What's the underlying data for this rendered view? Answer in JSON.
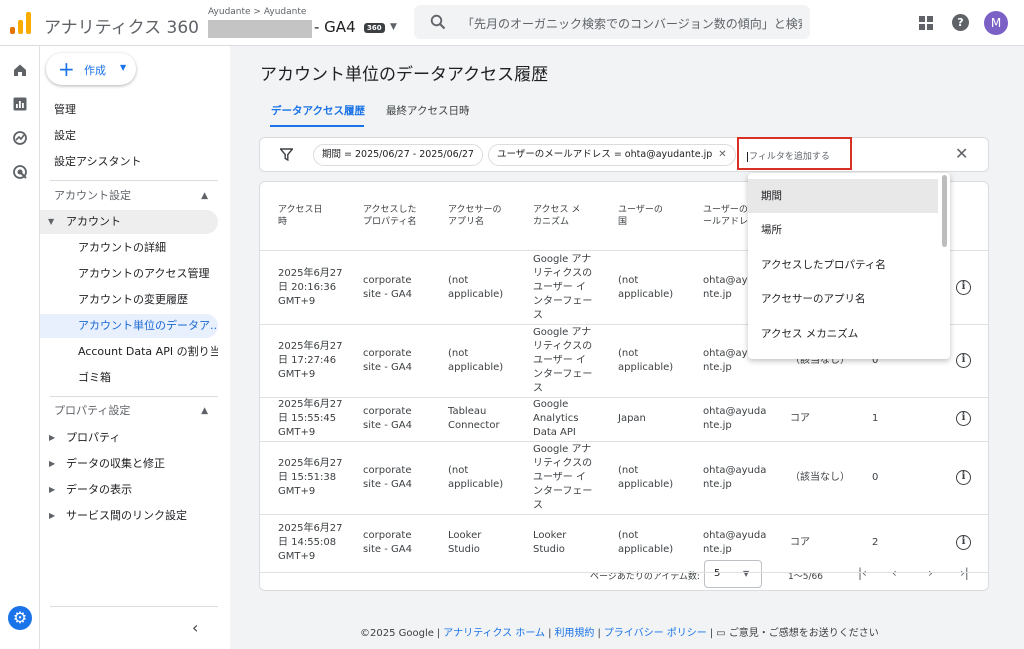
{
  "app": {
    "title": "アナリティクス 360",
    "account_crumb": "Ayudante > Ayudante",
    "property_name": "- GA4",
    "property_badge": "360"
  },
  "search": {
    "placeholder": "「先月のオーガニック検索でのコンバージョン数の傾向」と検索..."
  },
  "user": {
    "avatar_letter": "M"
  },
  "create_button": {
    "label": "作成"
  },
  "nav": {
    "top_items": [
      "管理",
      "設定",
      "設定アシスタント"
    ],
    "account_section": "アカウント設定",
    "account_group": "アカウント",
    "account_items": [
      "アカウントの詳細",
      "アカウントのアクセス管理",
      "アカウントの変更履歴",
      "アカウント単位のデータア...",
      "Account Data API の割り当...",
      "ゴミ箱"
    ],
    "property_section": "プロパティ設定",
    "property_groups": [
      "プロパティ",
      "データの収集と修正",
      "データの表示",
      "サービス間のリンク設定"
    ]
  },
  "page": {
    "title": "アカウント単位のデータアクセス履歴"
  },
  "tabs": [
    "データアクセス履歴",
    "最終アクセス日時"
  ],
  "filters": {
    "chips": [
      "期間 = 2025/06/27 - 2025/06/27",
      "ユーザーのメールアドレス = ohta@ayudante.jp"
    ],
    "input_placeholder": "フィルタを追加する"
  },
  "table": {
    "headers": [
      [
        "アクセス日",
        "時"
      ],
      [
        "アクセスした",
        "プロパティ名"
      ],
      [
        "アクセサーの",
        "アプリ名"
      ],
      [
        "アクセス メ",
        "カニズム"
      ],
      [
        "ユーザーの",
        "国"
      ],
      [
        "ユーザーのメ",
        "ールアドレス"
      ]
    ],
    "rows": [
      {
        "date": [
          "2025年6月27",
          "日 20:16:36",
          "GMT+9"
        ],
        "prop": [
          "corporate",
          "site - GA4"
        ],
        "app": [
          "(not",
          "applicable)"
        ],
        "mech": [
          "Google アナ",
          "リティクスの",
          "ユーザー イ",
          "ンターフェー",
          "ス"
        ],
        "country": [
          "(not",
          "applicable)"
        ],
        "email": [
          "ohta@ayuda",
          "nte.jp"
        ],
        "c7": [],
        "c8": []
      },
      {
        "date": [
          "2025年6月27",
          "日 17:27:46",
          "GMT+9"
        ],
        "prop": [
          "corporate",
          "site - GA4"
        ],
        "app": [
          "(not",
          "applicable)"
        ],
        "mech": [
          "Google アナ",
          "リティクスの",
          "ユーザー イ",
          "ンターフェー",
          "ス"
        ],
        "country": [
          "(not",
          "applicable)"
        ],
        "email": [
          "ohta@ayuda",
          "nte.jp"
        ],
        "c7": [
          "（該当なし）"
        ],
        "c8": [
          "0"
        ]
      },
      {
        "date": [
          "2025年6月27",
          "日 15:55:45",
          "GMT+9"
        ],
        "prop": [
          "corporate",
          "site - GA4"
        ],
        "app": [
          "Tableau",
          "Connector"
        ],
        "mech": [
          "Google",
          "Analytics",
          "Data API"
        ],
        "country": [
          "Japan"
        ],
        "email": [
          "ohta@ayuda",
          "nte.jp"
        ],
        "c7": [
          "コア"
        ],
        "c8": [
          "1"
        ]
      },
      {
        "date": [
          "2025年6月27",
          "日 15:51:38",
          "GMT+9"
        ],
        "prop": [
          "corporate",
          "site - GA4"
        ],
        "app": [
          "(not",
          "applicable)"
        ],
        "mech": [
          "Google アナ",
          "リティクスの",
          "ユーザー イ",
          "ンターフェー",
          "ス"
        ],
        "country": [
          "(not",
          "applicable)"
        ],
        "email": [
          "ohta@ayuda",
          "nte.jp"
        ],
        "c7": [
          "（該当なし）"
        ],
        "c8": [
          "0"
        ]
      },
      {
        "date": [
          "2025年6月27",
          "日 14:55:08",
          "GMT+9"
        ],
        "prop": [
          "corporate",
          "site - GA4"
        ],
        "app": [
          "Looker",
          "Studio"
        ],
        "mech": [
          "Looker",
          "Studio"
        ],
        "country": [
          "(not",
          "applicable)"
        ],
        "email": [
          "ohta@ayuda",
          "nte.jp"
        ],
        "c7": [
          "コア"
        ],
        "c8": [
          "2"
        ]
      }
    ]
  },
  "pagination": {
    "items_per_page_label": "ページあたりのアイテム数:",
    "items_per_page": "5",
    "range": "1〜5/66"
  },
  "dropdown": {
    "options": [
      "期間",
      "場所",
      "アクセスしたプロパティ名",
      "アクセサーのアプリ名",
      "アクセス メカニズム"
    ]
  },
  "footer": {
    "copyright": "©2025 Google",
    "links": [
      "アナリティクス ホーム",
      "利用規約",
      "プライバシー ポリシー"
    ],
    "feedback": "ご意見・ご感想をお送りください"
  },
  "colors": {
    "accent": "#1a73e8",
    "highlight_box": "#d93025",
    "logo_orange": "#f9ab00",
    "logo_dark": "#e37400",
    "avatar": "#7b61c5"
  }
}
